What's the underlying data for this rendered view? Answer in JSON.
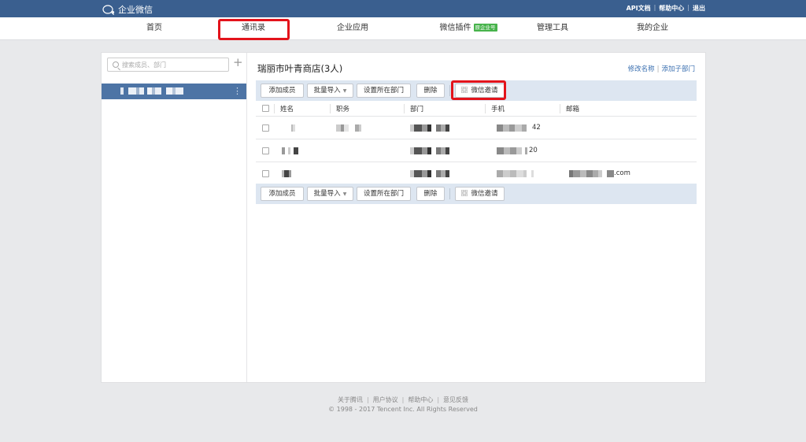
{
  "app": {
    "name": "企业微信"
  },
  "toplinks": [
    {
      "label": "API文档"
    },
    {
      "label": "帮助中心"
    },
    {
      "label": "退出"
    }
  ],
  "nav": [
    {
      "label": "首页"
    },
    {
      "label": "通讯录",
      "active": true
    },
    {
      "label": "企业应用"
    },
    {
      "label": "微信插件",
      "badge": "原企业号"
    },
    {
      "label": "管理工具"
    },
    {
      "label": "我的企业"
    }
  ],
  "sidebar": {
    "search_placeholder": "搜索成员、部门",
    "add_icon": "plus-icon",
    "selected_department": "[redacted]"
  },
  "main": {
    "title": "瑞丽市叶青商店(3人)",
    "links": [
      {
        "label": "修改名称"
      },
      {
        "label": "添加子部门"
      }
    ],
    "toolbar": {
      "add_member": "添加成员",
      "bulk_import": "批量导入",
      "set_department": "设置所在部门",
      "delete": "删除",
      "wechat_invite": "微信邀请"
    }
  },
  "table": {
    "columns": [
      "姓名",
      "职务",
      "部门",
      "手机",
      "邮箱"
    ],
    "rows": [
      {
        "name": "[redacted]",
        "title": "[redacted]",
        "department": "[redacted]",
        "phone_suffix": "42",
        "email_suffix": ""
      },
      {
        "name": "[redacted]",
        "title": "",
        "department": "[redacted]",
        "phone_suffix": "20",
        "email_suffix": ""
      },
      {
        "name": "[redacted]",
        "title": "",
        "department": "[redacted]",
        "phone_suffix": "",
        "email_suffix": ".com"
      }
    ]
  },
  "footer": {
    "links": [
      {
        "label": "关于腾讯"
      },
      {
        "label": "用户协议"
      },
      {
        "label": "帮助中心"
      },
      {
        "label": "意见反馈"
      }
    ],
    "copyright": "© 1998 - 2017 Tencent Inc. All Rights Reserved"
  },
  "colors": {
    "topbar": "#3a5f8f",
    "selected_row": "#4d74a5",
    "toolbar_bg": "#dde6f1",
    "highlight": "#e3131b",
    "badge": "#47b34b",
    "link": "#3a6fb0"
  }
}
